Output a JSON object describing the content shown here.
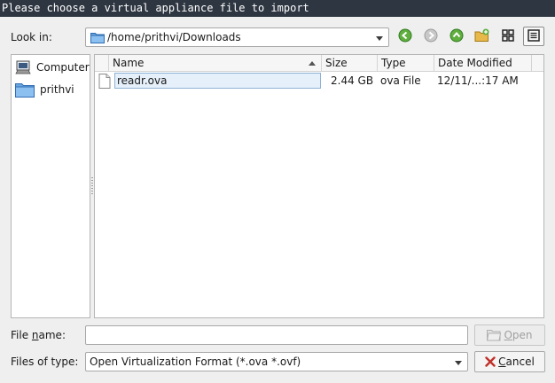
{
  "window": {
    "title": "Please choose a virtual appliance file to import"
  },
  "look_in": {
    "label_pre": "Look in:",
    "path": "/home/prithvi/Downloads"
  },
  "toolbar": {
    "icons": [
      "back-arrow-icon",
      "forward-arrow-icon",
      "up-arrow-icon",
      "new-folder-icon",
      "list-view-icon",
      "detail-view-icon"
    ],
    "accent_green": "#3a8a2a"
  },
  "places": [
    {
      "name": "Computer",
      "icon": "computer-icon"
    },
    {
      "name": "prithvi",
      "icon": "folder-icon"
    }
  ],
  "file_list": {
    "columns": [
      "Name",
      "Size",
      "Type",
      "Date Modified"
    ],
    "sort_column": "Name",
    "rows": [
      {
        "name": "readr.ova",
        "size": "2.44 GB",
        "type": "ova File",
        "date": "12/11/...:17 AM",
        "icon": "file-icon"
      }
    ]
  },
  "file_name": {
    "label_pre": "File ",
    "label_ul": "n",
    "label_post": "ame:",
    "value": ""
  },
  "file_type": {
    "label": "Files of type:",
    "value": "Open Virtualization Format (*.ova *.ovf)"
  },
  "buttons": {
    "open_ul": "O",
    "open_rest": "pen",
    "cancel_ul": "C",
    "cancel_rest": "ancel"
  }
}
